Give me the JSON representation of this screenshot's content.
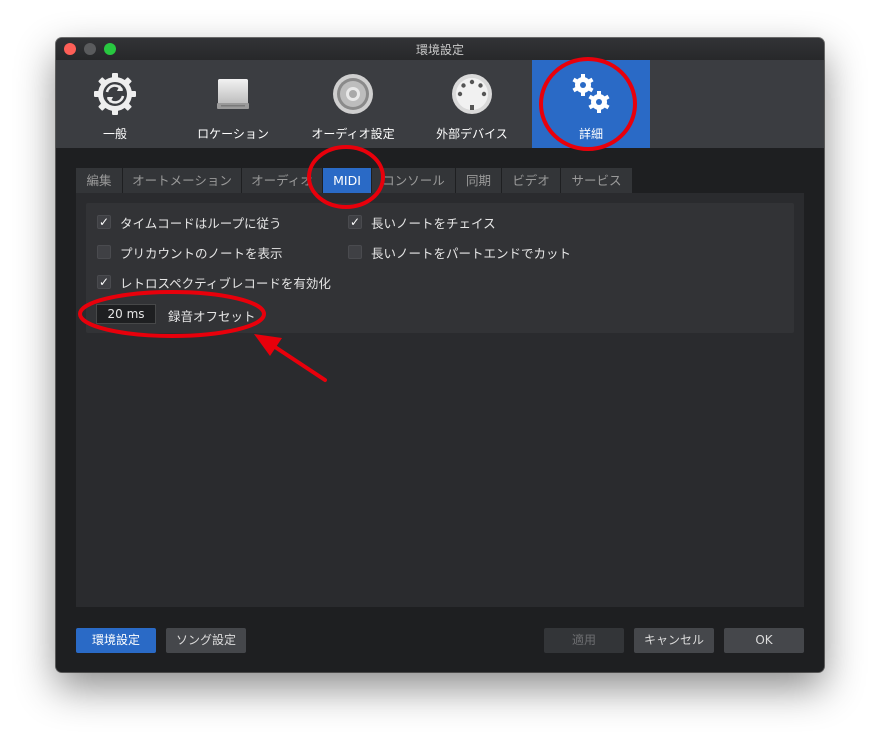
{
  "window": {
    "title": "環境設定"
  },
  "toolbar": {
    "items": [
      {
        "label": "一般",
        "icon": "sync-gear-icon"
      },
      {
        "label": "ロケーション",
        "icon": "drive-icon"
      },
      {
        "label": "オーディオ設定",
        "icon": "speaker-icon"
      },
      {
        "label": "外部デバイス",
        "icon": "midi-port-icon"
      },
      {
        "label": "詳細",
        "icon": "gears-icon",
        "active": true
      }
    ]
  },
  "tabs": [
    {
      "label": "編集"
    },
    {
      "label": "オートメーション"
    },
    {
      "label": "オーディオ"
    },
    {
      "label": "MIDI",
      "active": true
    },
    {
      "label": "コンソール"
    },
    {
      "label": "同期"
    },
    {
      "label": "ビデオ"
    },
    {
      "label": "サービス"
    }
  ],
  "midi": {
    "options": [
      {
        "label": "タイムコードはループに従う",
        "checked": true
      },
      {
        "label": "プリカウントのノートを表示",
        "checked": false
      },
      {
        "label": "レトロスペクティブレコードを有効化",
        "checked": true
      },
      {
        "label": "長いノートをチェイス",
        "checked": true
      },
      {
        "label": "長いノートをパートエンドでカット",
        "checked": false
      }
    ],
    "offset_value": "20 ms",
    "offset_label": "録音オフセット"
  },
  "footer": {
    "prefs_label": "環境設定",
    "song_label": "ソング設定",
    "apply_label": "適用",
    "cancel_label": "キャンセル",
    "ok_label": "OK"
  },
  "colors": {
    "accent": "#2a6ac6",
    "annotation": "#e8000b"
  }
}
